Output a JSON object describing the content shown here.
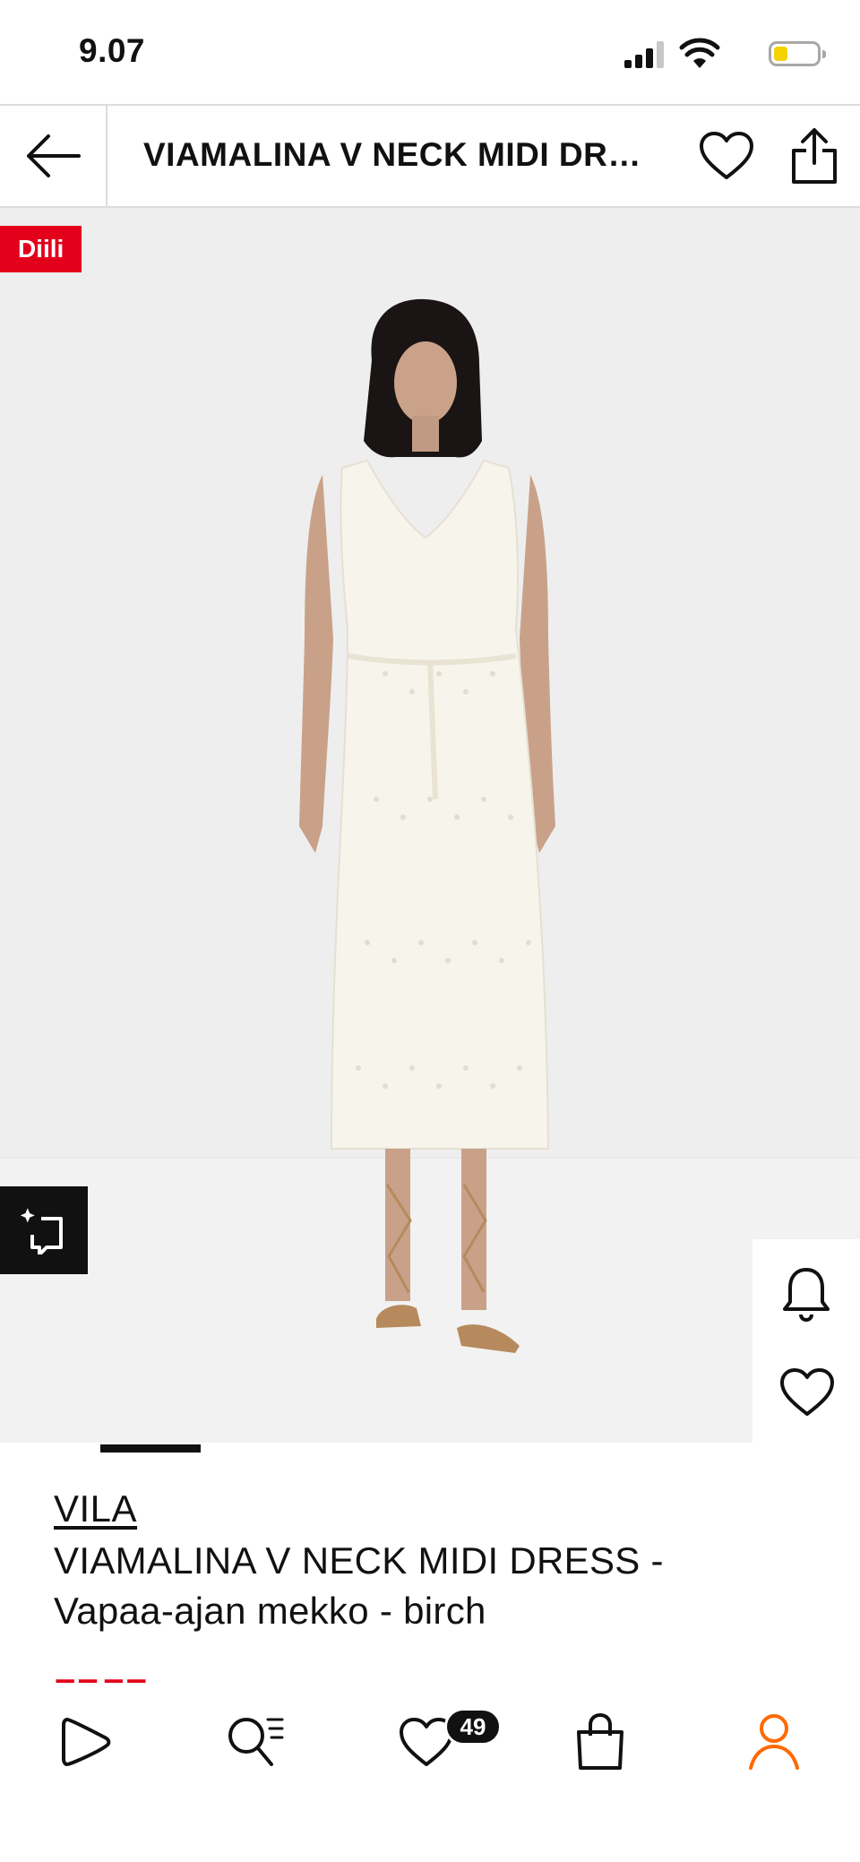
{
  "status_bar": {
    "time": "9.07",
    "battery_color": "#f5d200"
  },
  "header": {
    "title": "VIAMALINA V NECK MIDI DRESS - Vapaa-ajan mekko - birch",
    "back_icon": "arrow-left-icon",
    "wishlist_icon": "heart-outline-icon",
    "share_icon": "share-icon"
  },
  "product_image": {
    "deal_badge": "Diili",
    "deal_color": "#e3001b",
    "similar_icon": "similar-items-icon",
    "alert_icon": "bell-icon",
    "wishlist_icon": "heart-outline-icon"
  },
  "product": {
    "brand": "VILA",
    "name_line1": "VIAMALINA V NECK MIDI DRESS -",
    "name_line2": "Vapaa-ajan mekko - birch",
    "price_color": "#e3001b"
  },
  "bottom_nav": {
    "items": [
      {
        "name": "home",
        "icon": "play-icon"
      },
      {
        "name": "search",
        "icon": "search-list-icon"
      },
      {
        "name": "wishlist",
        "icon": "heart-outline-icon"
      },
      {
        "name": "cart",
        "icon": "shopping-bag-icon"
      },
      {
        "name": "profile",
        "icon": "person-icon"
      }
    ],
    "wishlist_count": "49",
    "profile_color": "#ff6900"
  }
}
